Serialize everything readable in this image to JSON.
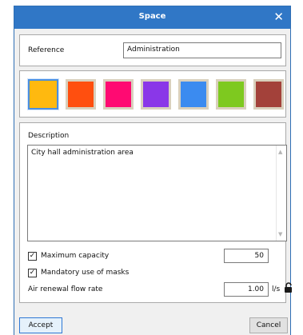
{
  "dialog": {
    "title": "Space",
    "close_glyph": "✕"
  },
  "reference": {
    "label": "Reference",
    "value": "Administration"
  },
  "colors": {
    "selected_index": 0,
    "swatches": [
      "#ffb90f",
      "#ff4f0f",
      "#ff0a72",
      "#8a37e8",
      "#3b8bf0",
      "#7ec91f",
      "#a3413a"
    ]
  },
  "description": {
    "label": "Description",
    "text": "City hall administration area"
  },
  "options": {
    "max_capacity": {
      "label": "Maximum capacity",
      "checked": true,
      "value": "50"
    },
    "masks": {
      "label": "Mandatory use of masks",
      "checked": true
    },
    "air_renewal": {
      "label": "Air renewal flow rate",
      "value": "1.00",
      "unit": "l/s",
      "icon": "lock-open-icon"
    }
  },
  "buttons": {
    "accept": "Accept",
    "cancel": "Cancel"
  }
}
